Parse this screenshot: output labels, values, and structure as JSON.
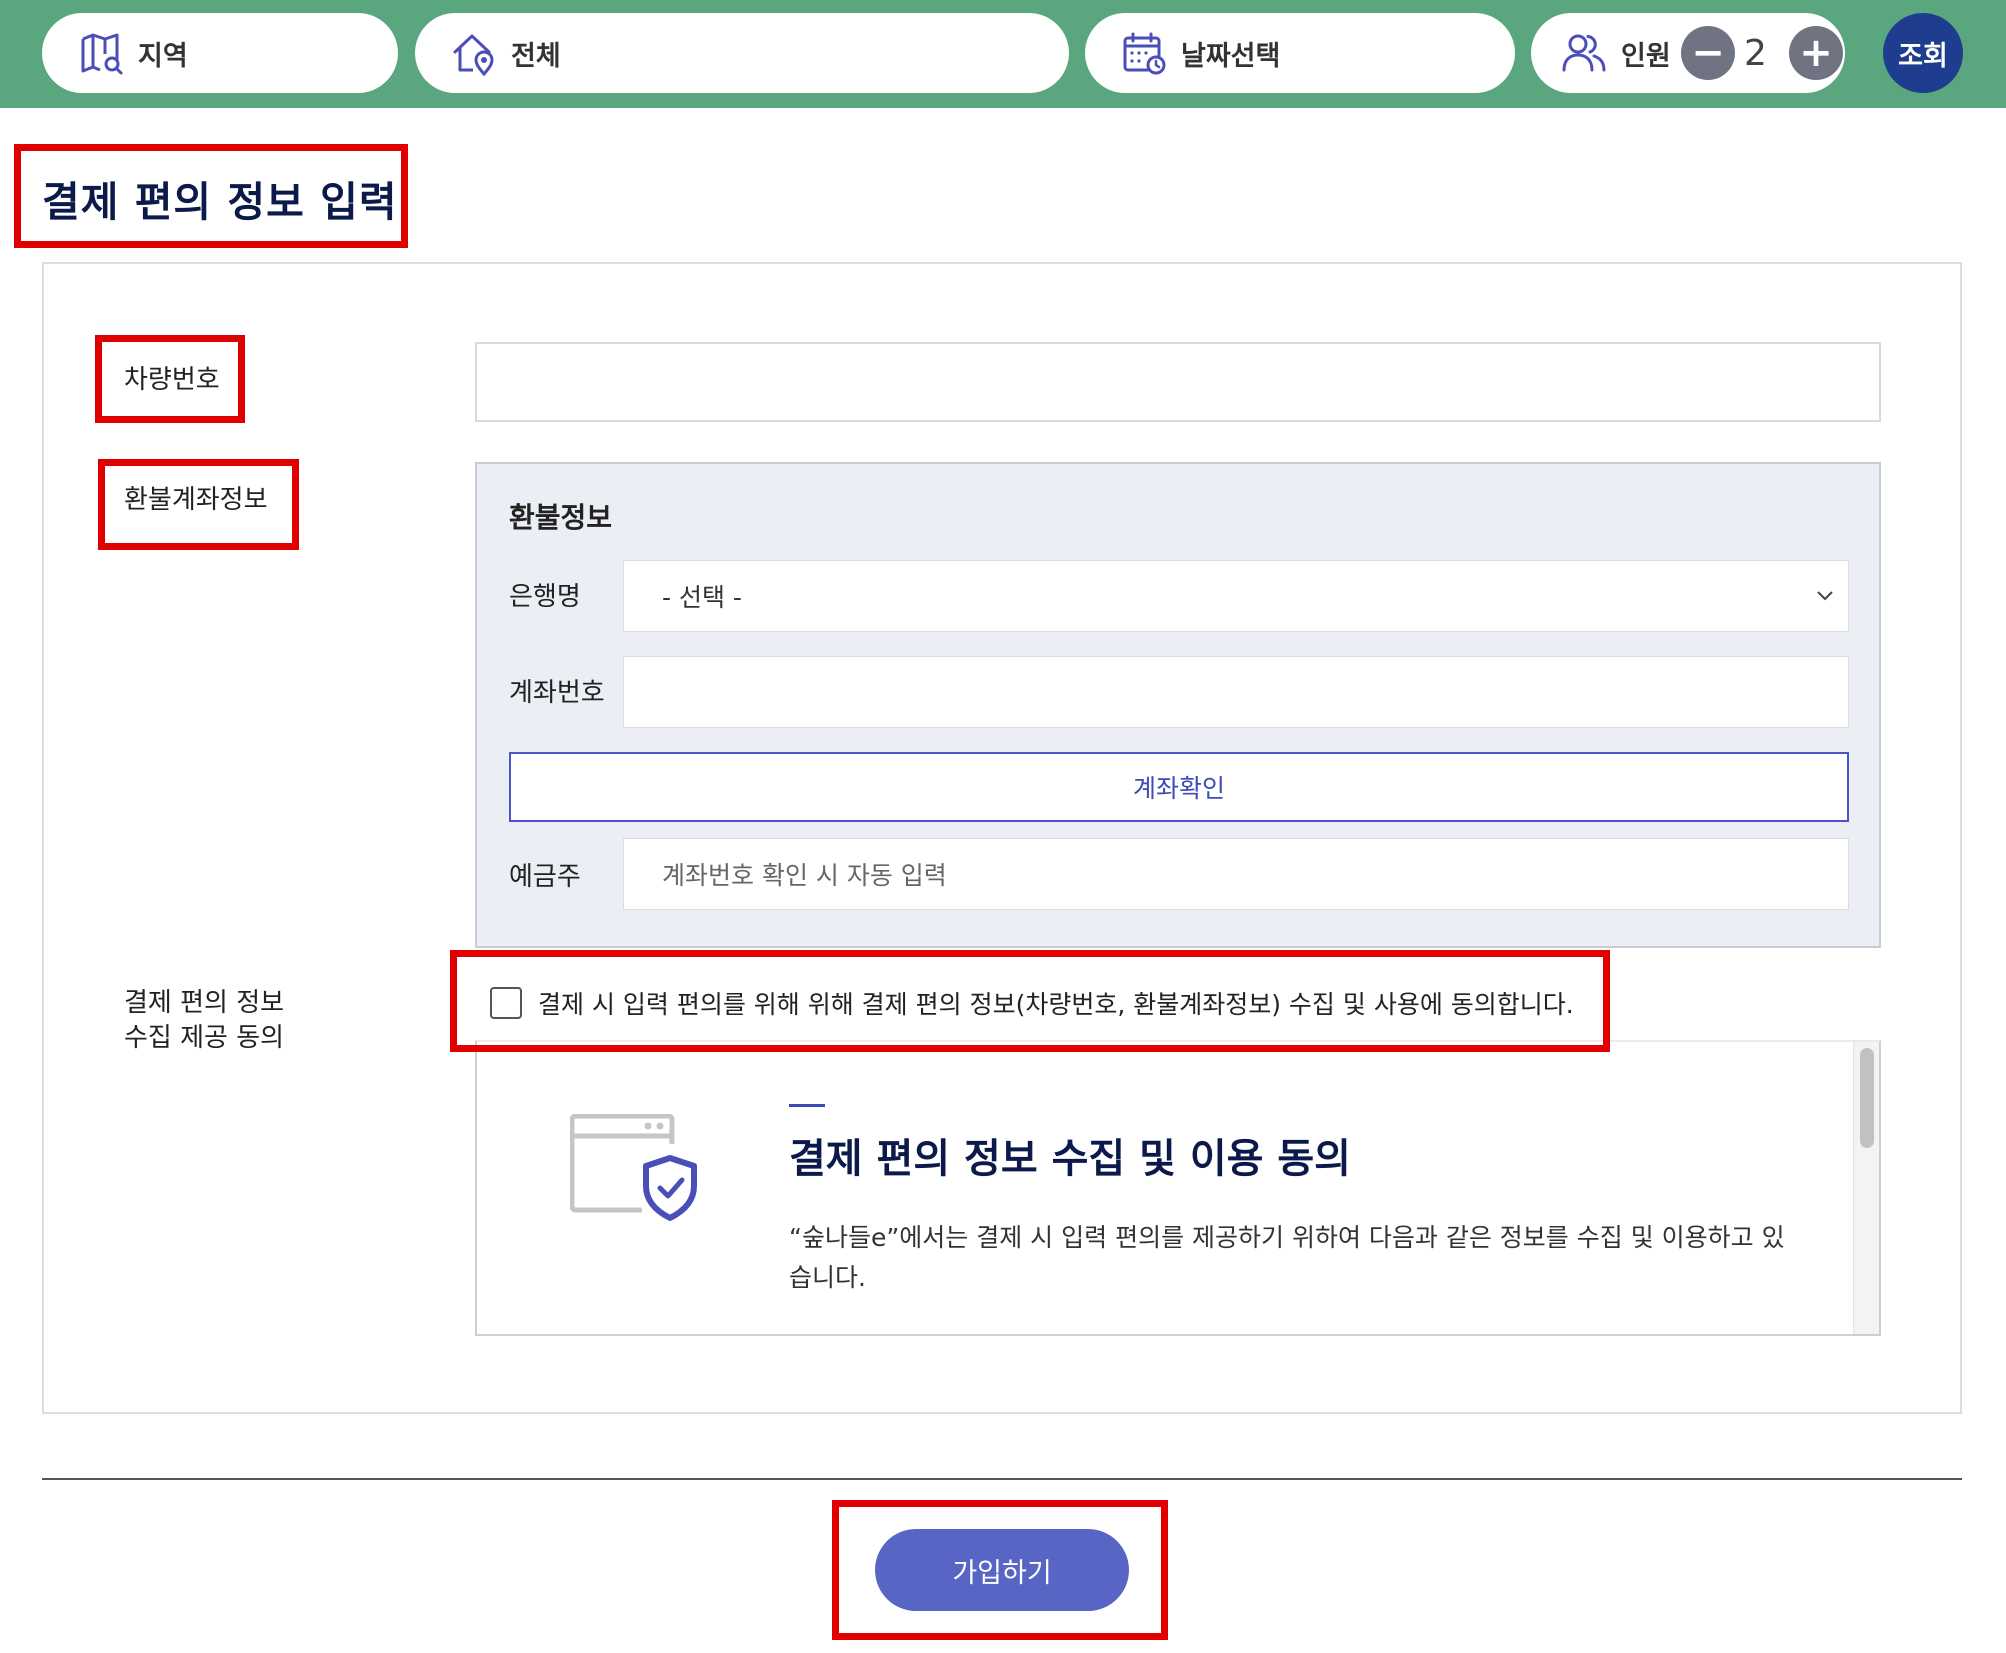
{
  "topbar": {
    "region_label": "지역",
    "all_label": "전체",
    "date_label": "날짜선택",
    "people_label": "인원",
    "minus_symbol": "−",
    "people_count": "2",
    "plus_symbol": "+",
    "search_label": "조회",
    "icons": [
      "map-icon",
      "home-location-icon",
      "calendar-icon",
      "people-icon"
    ]
  },
  "page": {
    "title": "결제 편의 정보 입력"
  },
  "form": {
    "vehicle_label": "차량번호",
    "vehicle_value": "",
    "refund_label": "환불계좌정보",
    "refund": {
      "title": "환불정보",
      "bank_label": "은행명",
      "bank_selected": "- 선택 -",
      "account_label": "계좌번호",
      "account_value": "",
      "verify_button": "계좌확인",
      "holder_label": "예금주",
      "holder_placeholder": "계좌번호 확인 시 자동 입력"
    },
    "consent_label_line1": "결제 편의 정보",
    "consent_label_line2": "수집 제공 동의",
    "consent_checkbox_text": "결제 시 입력 편의를 위해 위해 결제 편의 정보(차량번호, 환불계좌정보) 수집 및 사용에 동의합니다.",
    "consent_checked": false,
    "terms": {
      "title": "결제 편의 정보 수집 및 이용 동의",
      "body": "“숲나들e”에서는 결제 시 입력 편의를 제공하기 위하여 다음과 같은 정보를 수집 및 이용하고 있습니다."
    }
  },
  "submit_label": "가입하기",
  "colors": {
    "topbar_bg": "#5aa77f",
    "search_btn": "#1f3d8f",
    "accent": "#3d4ab8",
    "submit_btn": "#5865c4",
    "highlight": "#e00000"
  }
}
